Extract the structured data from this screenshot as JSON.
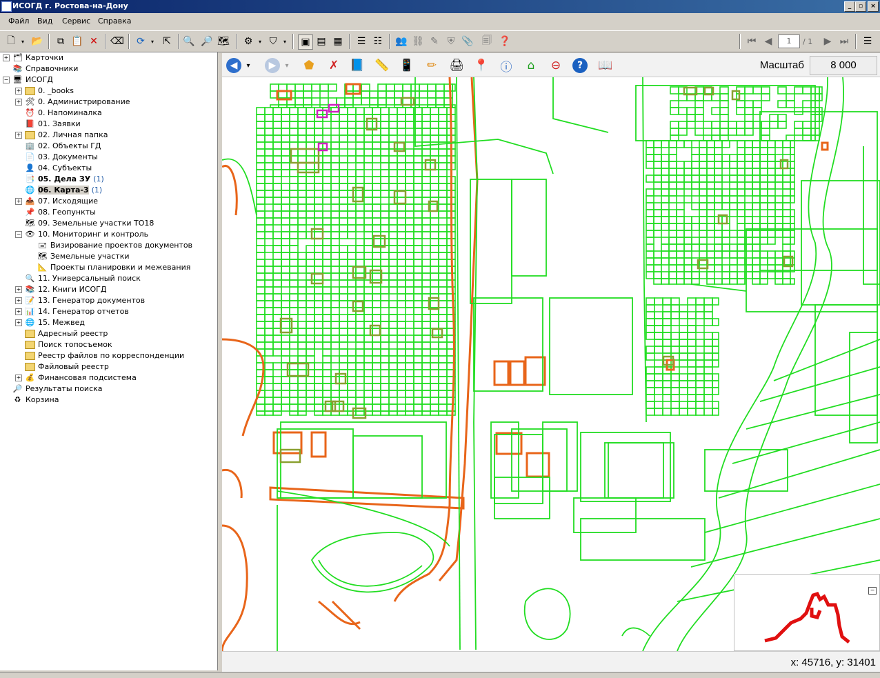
{
  "window": {
    "title": "ИСОГД г. Ростова-на-Дону"
  },
  "menu": [
    "Файл",
    "Вид",
    "Сервис",
    "Справка"
  ],
  "pager": {
    "page": "1",
    "total": "/ 1"
  },
  "tree": [
    {
      "label": "Карточки",
      "icon": "cards-icon",
      "exp": "+",
      "level": 0
    },
    {
      "label": "Справочники",
      "icon": "books-icon",
      "exp": "",
      "level": 0
    },
    {
      "label": "ИСОГД",
      "icon": "computer-icon",
      "exp": "−",
      "level": 0
    },
    {
      "label": "0. _books",
      "icon": "folder-icon",
      "exp": "+",
      "level": 1
    },
    {
      "label": "0. Администрирование",
      "icon": "tools-icon",
      "exp": "+",
      "level": 1
    },
    {
      "label": "0. Напоминалка",
      "icon": "clock-icon",
      "exp": "",
      "level": 1
    },
    {
      "label": "01. Заявки",
      "icon": "book-icon",
      "exp": "",
      "level": 1
    },
    {
      "label": "02. Личная папка",
      "icon": "folder-icon",
      "exp": "+",
      "level": 1
    },
    {
      "label": "02. Объекты ГД",
      "icon": "building-icon",
      "exp": "",
      "level": 1
    },
    {
      "label": "03. Документы",
      "icon": "document-icon",
      "exp": "",
      "level": 1
    },
    {
      "label": "04. Субъекты",
      "icon": "person-icon",
      "exp": "",
      "level": 1
    },
    {
      "label": "05. Дела ЗУ",
      "count": "(1)",
      "icon": "case-icon",
      "exp": "",
      "level": 1,
      "bold": true
    },
    {
      "label": "06. Карта-3",
      "count": "(1)",
      "icon": "globe-icon",
      "exp": "",
      "level": 1,
      "bold": true,
      "selected": true
    },
    {
      "label": "07. Исходящие",
      "icon": "outgoing-icon",
      "exp": "+",
      "level": 1
    },
    {
      "label": "08. Геопункты",
      "icon": "geopoint-icon",
      "exp": "",
      "level": 1
    },
    {
      "label": "09. Земельные участки ТО18",
      "icon": "parcel-icon",
      "exp": "",
      "level": 1
    },
    {
      "label": "10. Мониторинг и контроль",
      "icon": "monitor-icon",
      "exp": "−",
      "level": 1
    },
    {
      "label": "Визирование проектов документов",
      "icon": "stamp-icon",
      "exp": "",
      "level": 2
    },
    {
      "label": "Земельные участки",
      "icon": "map-icon",
      "exp": "",
      "level": 2
    },
    {
      "label": "Проекты планировки и межевания",
      "icon": "ruler-icon",
      "exp": "",
      "level": 2
    },
    {
      "label": "11. Универсальный поиск",
      "icon": "search-icon",
      "exp": "",
      "level": 1
    },
    {
      "label": "12. Книги ИСОГД",
      "icon": "books-icon",
      "exp": "+",
      "level": 1
    },
    {
      "label": "13. Генератор документов",
      "icon": "doc-gen-icon",
      "exp": "+",
      "level": 1
    },
    {
      "label": "14. Генератор отчетов",
      "icon": "report-icon",
      "exp": "+",
      "level": 1
    },
    {
      "label": "15. Межвед",
      "icon": "globe-icon",
      "exp": "+",
      "level": 1
    },
    {
      "label": "Адресный реестр",
      "icon": "folder-icon",
      "exp": "",
      "level": 1
    },
    {
      "label": "Поиск топосъемок",
      "icon": "folder-icon",
      "exp": "",
      "level": 1
    },
    {
      "label": "Реестр файлов по корреспонденции",
      "icon": "folder-icon",
      "exp": "",
      "level": 1
    },
    {
      "label": "Файловый реестр",
      "icon": "folder-icon",
      "exp": "",
      "level": 1
    },
    {
      "label": "Финансовая подсистема",
      "icon": "finance-icon",
      "exp": "+",
      "level": 1
    },
    {
      "label": "Результаты поиска",
      "icon": "search-results-icon",
      "exp": "",
      "level": 0
    },
    {
      "label": "Корзина",
      "icon": "recycle-icon",
      "exp": "",
      "level": 0
    }
  ],
  "map": {
    "scale_label": "Масштаб",
    "scale_value": "8 000",
    "coords": "x: 45716, y: 31401"
  },
  "colors": {
    "parcel": "#22dd22",
    "boundary": "#e8651a",
    "highlight": "#d020c0",
    "overview": "#e01010"
  }
}
